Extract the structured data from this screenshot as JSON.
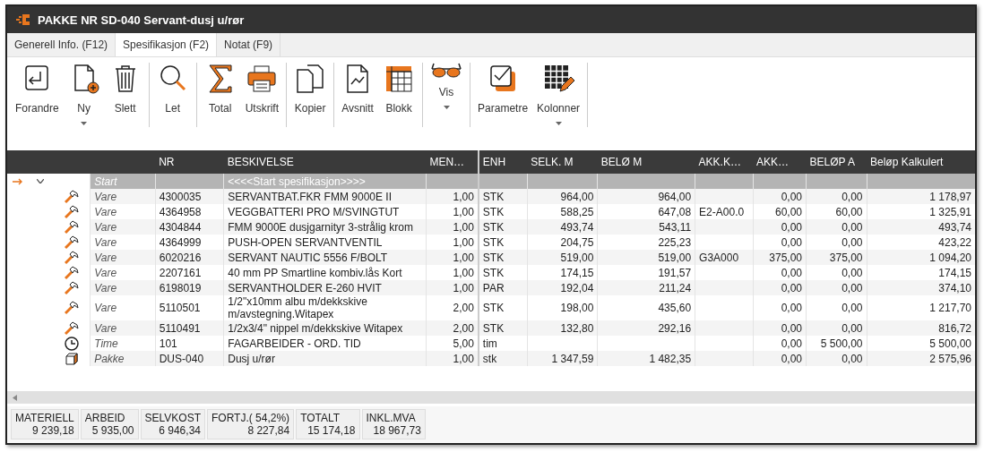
{
  "window": {
    "title": "PAKKE NR SD-040 Servant-dusj u/rør"
  },
  "tabs": [
    {
      "label": "Generell Info. (F12)",
      "selected": false
    },
    {
      "label": "Spesifikasjon (F2)",
      "selected": true
    },
    {
      "label": "Notat (F9)",
      "selected": false
    }
  ],
  "toolbar": [
    {
      "buttons": [
        {
          "kind": "change",
          "label": "Forandre",
          "dropdown": false
        },
        {
          "kind": "new",
          "label": "Ny",
          "dropdown": true
        },
        {
          "kind": "delete",
          "label": "Slett",
          "dropdown": false
        }
      ]
    },
    {
      "buttons": [
        {
          "kind": "search",
          "label": "Let",
          "dropdown": false
        }
      ]
    },
    {
      "buttons": [
        {
          "kind": "sum",
          "label": "Total",
          "dropdown": false
        },
        {
          "kind": "print",
          "label": "Utskrift",
          "dropdown": false
        }
      ]
    },
    {
      "buttons": [
        {
          "kind": "copy",
          "label": "Kopier",
          "dropdown": false
        }
      ]
    },
    {
      "buttons": [
        {
          "kind": "chart",
          "label": "Avsnitt",
          "dropdown": false
        },
        {
          "kind": "grid",
          "label": "Blokk",
          "dropdown": false
        }
      ]
    },
    {
      "buttons": [
        {
          "kind": "glasses",
          "label": "Vis",
          "dropdown": true
        }
      ]
    },
    {
      "buttons": [
        {
          "kind": "check",
          "label": "Parametre",
          "dropdown": false
        },
        {
          "kind": "columns",
          "label": "Kolonner",
          "dropdown": true
        }
      ]
    }
  ],
  "table": {
    "columns": [
      "NR",
      "BESKIVELSE",
      "MEN…",
      "ENH",
      "SELK. M",
      "BELØ M",
      "AKK.K…",
      "AKK…",
      "BELØP A",
      "Beløp Kalkulert"
    ],
    "rows": [
      {
        "kind": "start",
        "current": true,
        "expanded": true,
        "type": "Start",
        "cells": [
          "",
          "<<<<Start spesifikasjon>>>>",
          "",
          "",
          "",
          "",
          "",
          "",
          "",
          ""
        ]
      },
      {
        "kind": "vare",
        "current": false,
        "type": "Vare",
        "cells": [
          "4300035",
          "SERVANTBAT.FKR FMM 9000E II",
          "1,00",
          "STK",
          "964,00",
          "964,00",
          "",
          "0,00",
          "0,00",
          "1 178,97"
        ]
      },
      {
        "kind": "vare",
        "current": false,
        "type": "Vare",
        "cells": [
          "4364958",
          "VEGGBATTERI PRO M/SVINGTUT",
          "1,00",
          "STK",
          "588,25",
          "647,08",
          "E2-A00.0",
          "60,00",
          "60,00",
          "1 325,91"
        ]
      },
      {
        "kind": "vare",
        "current": false,
        "type": "Vare",
        "cells": [
          "4304844",
          "FMM 9000E dusjgarnityr 3-strålig krom",
          "1,00",
          "STK",
          "493,74",
          "543,11",
          "",
          "0,00",
          "0,00",
          "493,74"
        ]
      },
      {
        "kind": "vare",
        "current": false,
        "type": "Vare",
        "cells": [
          "4364999",
          "PUSH-OPEN SERVANTVENTIL",
          "1,00",
          "STK",
          "204,75",
          "225,23",
          "",
          "0,00",
          "0,00",
          "423,22"
        ]
      },
      {
        "kind": "vare",
        "current": false,
        "type": "Vare",
        "cells": [
          "6020216",
          "SERVANT NAUTIC 5556 F/BOLT",
          "1,00",
          "STK",
          "519,00",
          "519,00",
          "G3A000",
          "375,00",
          "375,00",
          "1 094,20"
        ]
      },
      {
        "kind": "vare",
        "current": false,
        "type": "Vare",
        "cells": [
          "2207161",
          "40 mm PP Smartline kombiv.lås Kort",
          "1,00",
          "STK",
          "174,15",
          "191,57",
          "",
          "0,00",
          "0,00",
          "174,15"
        ]
      },
      {
        "kind": "vare",
        "current": false,
        "type": "Vare",
        "cells": [
          "6198019",
          "SERVANTHOLDER E-260 HVIT",
          "1,00",
          "PAR",
          "192,04",
          "211,24",
          "",
          "0,00",
          "0,00",
          "374,10"
        ]
      },
      {
        "kind": "vare",
        "current": false,
        "type": "Vare",
        "cells": [
          "5110501",
          "1/2\"x10mm albu m/dekkskive m/avstegning.Witapex",
          "2,00",
          "STK",
          "198,00",
          "435,60",
          "",
          "0,00",
          "0,00",
          "1 217,70"
        ]
      },
      {
        "kind": "vare",
        "current": false,
        "type": "Vare",
        "cells": [
          "5110491",
          "1/2x3/4\" nippel m/dekkskive Witapex",
          "2,00",
          "STK",
          "132,80",
          "292,16",
          "",
          "0,00",
          "0,00",
          "816,72"
        ]
      },
      {
        "kind": "time",
        "current": false,
        "type": "Time",
        "cells": [
          "101",
          "FAGARBEIDER - ORD. TID",
          "5,00",
          "tim",
          "",
          "",
          "",
          "0,00",
          "5 500,00",
          "5 500,00"
        ]
      },
      {
        "kind": "pakke",
        "current": false,
        "type": "Pakke",
        "cells": [
          "DUS-040",
          "Dusj u/rør",
          "1,00",
          "stk",
          "1 347,59",
          "1 482,35",
          "",
          "0,00",
          "0,00",
          "2 575,96"
        ]
      }
    ]
  },
  "summary": [
    {
      "label": "MATERIELL",
      "value": "9 239,18"
    },
    {
      "label": "ARBEID",
      "value": "5 935,00"
    },
    {
      "label": "SELVKOST",
      "value": "6 946,34"
    },
    {
      "label": "FORTJ.(  54,2%)",
      "value": "8 227,84"
    },
    {
      "label": "TOTALT",
      "value": "15 174,18"
    },
    {
      "label": "INKL.MVA",
      "value": "18 967,73"
    }
  ]
}
